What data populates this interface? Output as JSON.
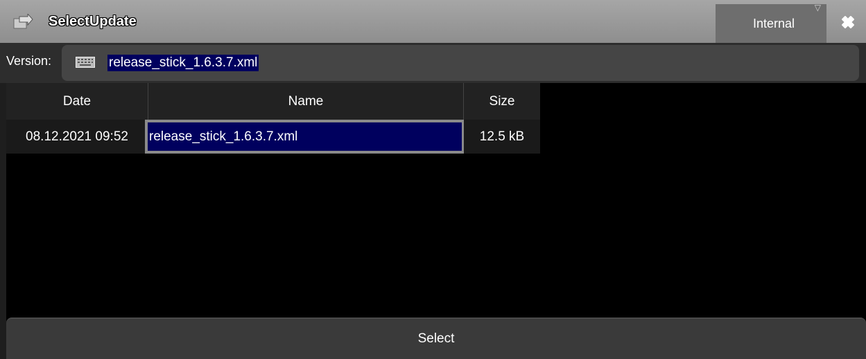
{
  "dialog": {
    "title": "SelectUpdate",
    "source_button_label": "Internal"
  },
  "version": {
    "label": "Version:",
    "value": "release_stick_1.6.3.7.xml"
  },
  "table": {
    "columns": [
      "Date",
      "Name",
      "Size"
    ],
    "rows": [
      {
        "date": "08.12.2021 09:52",
        "name": "release_stick_1.6.3.7.xml",
        "size": "12.5 kB"
      }
    ]
  },
  "footer": {
    "select_label": "Select"
  },
  "colors": {
    "titlebar": "#9a9a9a",
    "selection": "#00005e",
    "panel": "#2d2d2d"
  },
  "icons": [
    "update-icon",
    "close-icon",
    "keyboard-icon",
    "dropdown-arrow-icon"
  ]
}
